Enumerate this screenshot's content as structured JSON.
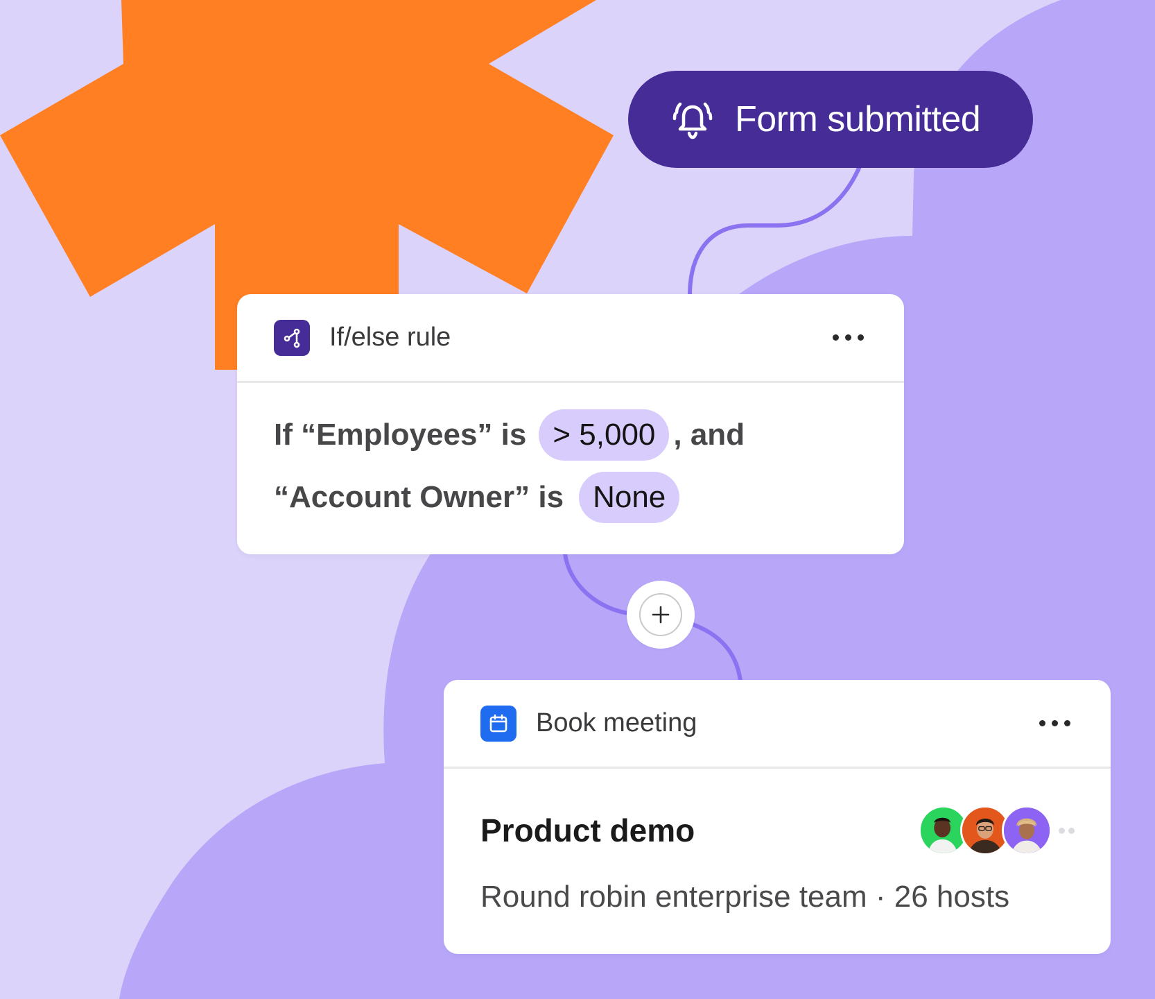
{
  "colors": {
    "background": "#dcd3fa",
    "blob": "#b8a7f9",
    "accent_orange": "#ff7f22",
    "trigger_pill": "#462c96",
    "connector": "#8b72f0",
    "chip": "#d7ccfb",
    "rule_icon_bg": "#462c96",
    "calendar_icon_bg": "#1f6cf0"
  },
  "trigger": {
    "icon": "bell-icon",
    "label": "Form submitted"
  },
  "rule_card": {
    "icon": "branch-icon",
    "title": "If/else rule",
    "menu_icon": "more-horizontal-icon",
    "line1": {
      "prefix": "If “Employees” is",
      "chip": "> 5,000",
      "suffix": ", and"
    },
    "line2": {
      "prefix": "“Account Owner” is",
      "chip": "None"
    }
  },
  "add_step": {
    "icon": "plus-icon"
  },
  "book_card": {
    "icon": "calendar-icon",
    "title": "Book meeting",
    "menu_icon": "more-horizontal-icon",
    "event_name": "Product demo",
    "description": "Round robin enterprise team · 26 hosts",
    "avatars": [
      {
        "name": "host-avatar-1",
        "bg": "#2bd45c"
      },
      {
        "name": "host-avatar-2",
        "bg": "#e4571c"
      },
      {
        "name": "host-avatar-3",
        "bg": "#8c63f2"
      }
    ]
  }
}
